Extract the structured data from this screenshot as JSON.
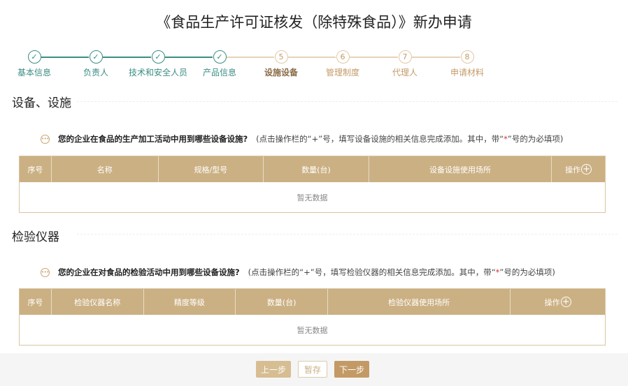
{
  "title": "《食品生产许可证核发（除特殊食品）》新办申请",
  "steps": [
    {
      "label": "基本信息",
      "status": "done",
      "num": "✓"
    },
    {
      "label": "负责人",
      "status": "done",
      "num": "✓"
    },
    {
      "label": "技术和安全人员",
      "status": "done",
      "num": "✓"
    },
    {
      "label": "产品信息",
      "status": "done",
      "num": "✓"
    },
    {
      "label": "设施设备",
      "status": "current",
      "num": "5"
    },
    {
      "label": "管理制度",
      "status": "todo",
      "num": "6"
    },
    {
      "label": "代理人",
      "status": "todo",
      "num": "7"
    },
    {
      "label": "申请材料",
      "status": "todo",
      "num": "8"
    }
  ],
  "colors": {
    "done": "#3a8d82",
    "todo_line": "#e6d3b8",
    "accent": "#c39a65",
    "header": "#cbb083"
  },
  "equipment": {
    "heading": "设备、设施",
    "question": "您的企业在食品的生产加工活动中用到哪些设备设施?",
    "hint_prefix": "(点击操作栏的“+”号，填写设备设施的相关信息完成添加。其中，带“",
    "hint_star": "*",
    "hint_suffix": "”号的为必填项)",
    "columns": [
      "序号",
      "名称",
      "规格/型号",
      "数量(台)",
      "设备设施使用场所",
      "操作"
    ],
    "empty": "暂无数据"
  },
  "instruments": {
    "heading": "检验仪器",
    "question": "您的企业在对食品的检验活动中用到哪些设备设施?",
    "hint_prefix": "(点击操作栏的“+”号，填写检验仪器的相关信息完成添加。其中，带“",
    "hint_star": "*",
    "hint_suffix": "”号的为必填项)",
    "columns": [
      "序号",
      "检验仪器名称",
      "精度等级",
      "数量(台)",
      "检验仪器使用场所",
      "操作"
    ],
    "empty": "暂无数据"
  },
  "footer": {
    "prev": "上一步",
    "save": "暂存",
    "next": "下一步"
  }
}
